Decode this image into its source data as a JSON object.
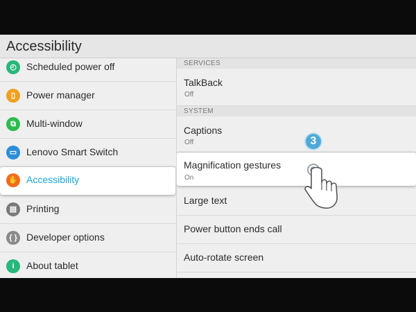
{
  "title": "Accessibility",
  "left_items": [
    {
      "label": "Scheduled power off",
      "icon": "power-clock-icon",
      "color": "#27b77a"
    },
    {
      "label": "Power manager",
      "icon": "battery-icon",
      "color": "#f0a020"
    },
    {
      "label": "Multi-window",
      "icon": "multi-window-icon",
      "color": "#2dbb4f"
    },
    {
      "label": "Lenovo Smart Switch",
      "icon": "smart-switch-icon",
      "color": "#2a8fd8"
    },
    {
      "label": "Accessibility",
      "icon": "hand-icon",
      "color": "#f26b1d",
      "selected": true
    },
    {
      "label": "Printing",
      "icon": "printer-icon",
      "color": "#7a7a7a"
    },
    {
      "label": "Developer options",
      "icon": "code-braces-icon",
      "color": "#8a8a8a"
    },
    {
      "label": "About tablet",
      "icon": "info-icon",
      "color": "#27b77a"
    }
  ],
  "right": {
    "services_header": "SERVICES",
    "talkback": {
      "title": "TalkBack",
      "status": "Off"
    },
    "system_header": "SYSTEM",
    "captions": {
      "title": "Captions",
      "status": "Off"
    },
    "magnification": {
      "title": "Magnification gestures",
      "status": "On"
    },
    "large_text": "Large text",
    "power_button": "Power button ends call",
    "auto_rotate": "Auto-rotate screen"
  },
  "step_badge": "3",
  "colors": {
    "accent": "#1aa6d9",
    "badge": "#4ea9d8"
  }
}
